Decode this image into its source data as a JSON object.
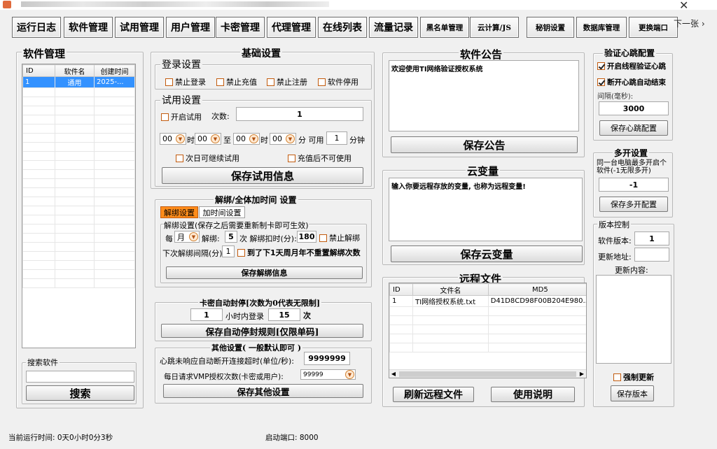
{
  "window": {
    "close": "✕"
  },
  "toptabs": [
    "运行日志",
    "软件管理",
    "试用管理",
    "用户管理",
    "卡密管理",
    "代理管理",
    "在线列表",
    "流量记录",
    "黑名单管理",
    "云计算/JS",
    "秘钥设置",
    "数据库管理",
    "更换端口"
  ],
  "next": "下一张 ›",
  "software": {
    "title": "软件管理",
    "headers": [
      "ID",
      "软件名",
      "创建时间"
    ],
    "row": [
      "1",
      "通用",
      "2025-..."
    ],
    "search_title": "搜索软件",
    "search_value": "",
    "search_button": "搜索"
  },
  "basic": {
    "title": "基础设置",
    "login_title": "登录设置",
    "login_opts": [
      "禁止登录",
      "禁止充值",
      "禁止注册",
      "软件停用"
    ],
    "trial_title": "试用设置",
    "trial_enable": "开启试用",
    "count_label": "次数:",
    "count_value": "1",
    "time": {
      "h1": "00",
      "m1": "00",
      "h2": "00",
      "m2": "00",
      "shi": "时",
      "zhi": "至",
      "fen_keyong": "分 可用",
      "minutes_value": "1",
      "fenzhong": "分钟"
    },
    "next_day": "次日可继续试用",
    "no_after_recharge": "充值后不可使用",
    "save_trial": "保存试用信息"
  },
  "unbind": {
    "title": "解绑/全体加时间 设置",
    "tab1": "解绑设置",
    "tab2": "加时间设置",
    "group_label": "解绑设置(保存之后需要重新制卡即可生效)",
    "every": "每",
    "period": "月",
    "unbind_label": "解绑:",
    "times_value": "5",
    "deduct_label": "次 解绑扣时(分):",
    "deduct_value": "180",
    "forbid": "禁止解绑",
    "interval_label": "下次解绑间隔(分)",
    "interval_value": "1",
    "reset_label": "到了下1天周月年不重置解绑次数",
    "save": "保存解绑信息"
  },
  "autoseal": {
    "title": "卡密自动封停[次数为0代表无限制]",
    "hours_value": "1",
    "hours_label": "小时内登录",
    "count_value": "15",
    "count_label": "次",
    "save": "保存自动停封规则[仅限单码]"
  },
  "other": {
    "title": "其他设置( 一般默认即可 )",
    "timeout_label": "心跳未响应自动断开连接超时(单位/秒):",
    "timeout_value": "9999999",
    "vmp_label": "每日请求VMP授权次数(卡密或用户):",
    "vmp_value": "99999",
    "save": "保存其他设置"
  },
  "notice": {
    "title": "软件公告",
    "text": "欢迎使用TI网络验证授权系统",
    "save": "保存公告"
  },
  "cloudvar": {
    "title": "云变量",
    "text": "输入你要远程存放的变量, 也称为远程变量!",
    "save": "保存云变量"
  },
  "remote": {
    "title": "远程文件",
    "headers": [
      "ID",
      "文件名",
      "MD5"
    ],
    "row": [
      "1",
      "TI网络授权系统.txt",
      "D41D8CD98F00B204E980..."
    ],
    "refresh": "刷新远程文件",
    "help": "使用说明"
  },
  "heartbeat": {
    "title": "验证心跳配置",
    "opt1": "开启线程验证心跳",
    "opt2": "断开心跳自动结束",
    "interval_label": "间隔(毫秒):",
    "interval_value": "3000",
    "save": "保存心跳配置"
  },
  "multi": {
    "title": "多开设置",
    "desc": "同一台电脑最多开启个软件(-1无限多开)",
    "value": "-1",
    "save": "保存多开配置"
  },
  "version": {
    "title": "版本控制",
    "ver_label": "软件版本:",
    "ver_value": "1",
    "url_label": "更新地址:",
    "url_value": "",
    "content_label": "更新内容:",
    "content_value": "",
    "force": "强制更新",
    "save": "保存版本"
  },
  "status": {
    "runtime": "当前运行时间: 0天0小时0分3秒",
    "port": "启动端口: 8000"
  }
}
